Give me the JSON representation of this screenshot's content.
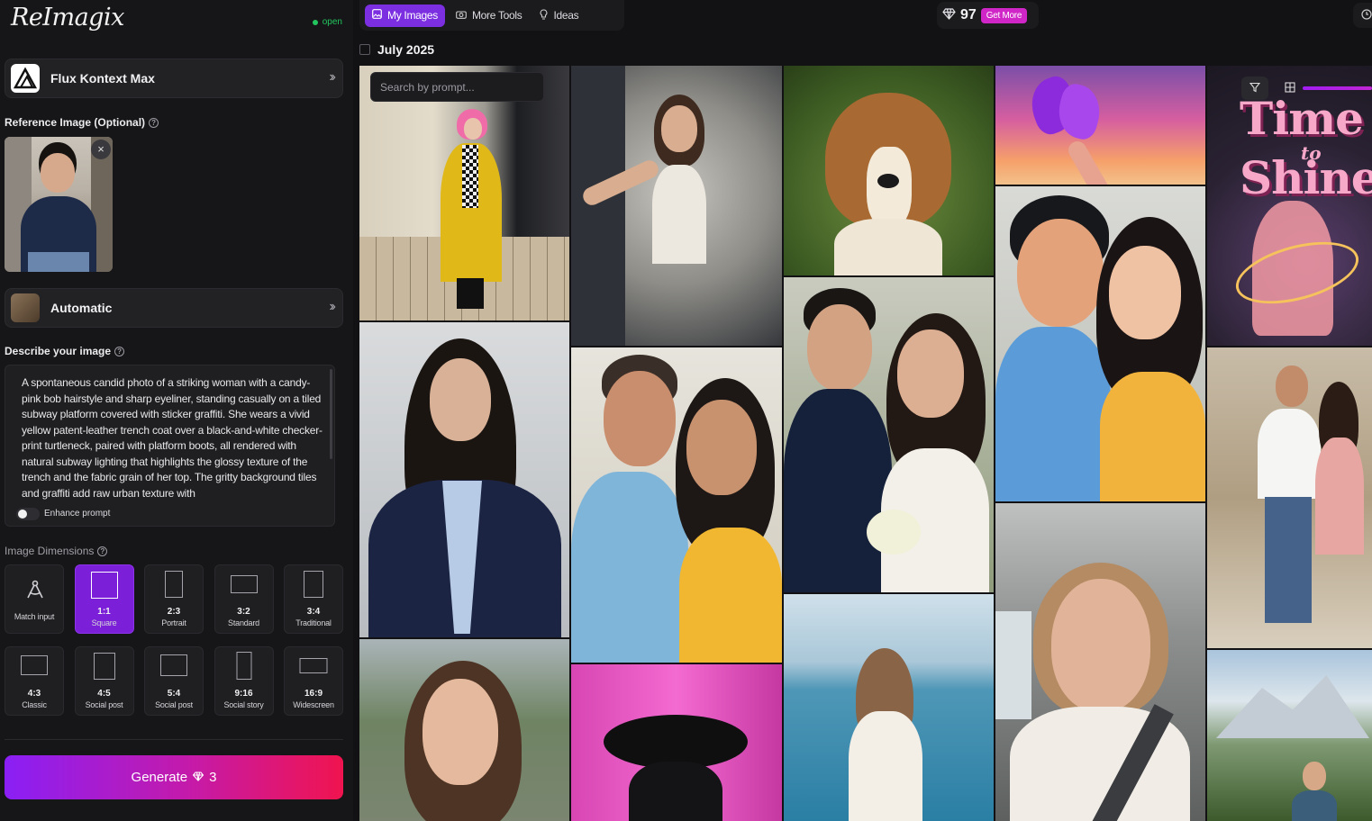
{
  "app": {
    "logo": "ReImagix",
    "status": "open"
  },
  "model": {
    "label": "Flux Kontext Max"
  },
  "reference": {
    "label": "Reference Image (Optional)"
  },
  "style": {
    "label": "Automatic"
  },
  "prompt": {
    "label": "Describe your image",
    "text": "A spontaneous candid photo of a striking woman with a candy-pink bob hairstyle and sharp eyeliner, standing casually on a tiled subway platform covered with sticker graffiti. She wears a vivid yellow patent-leather trench coat over a black-and-white checker-print turtleneck, paired with platform boots, all rendered with natural subway lighting that highlights the glossy texture of the trench and the fabric grain of her top. The gritty background tiles and graffiti add raw urban texture with",
    "enhance_label": "Enhance prompt",
    "enhance_on": false
  },
  "dimensions": {
    "label": "Image Dimensions",
    "selected": "1:1",
    "options": [
      {
        "ratio": "",
        "name": "Match input"
      },
      {
        "ratio": "1:1",
        "name": "Square"
      },
      {
        "ratio": "2:3",
        "name": "Portrait"
      },
      {
        "ratio": "3:2",
        "name": "Standard"
      },
      {
        "ratio": "3:4",
        "name": "Traditional"
      },
      {
        "ratio": "4:3",
        "name": "Classic"
      },
      {
        "ratio": "4:5",
        "name": "Social post"
      },
      {
        "ratio": "5:4",
        "name": "Social post"
      },
      {
        "ratio": "9:16",
        "name": "Social story"
      },
      {
        "ratio": "16:9",
        "name": "Widescreen"
      }
    ]
  },
  "generate": {
    "label": "Generate",
    "cost": "3"
  },
  "tabs": [
    {
      "label": "My Images",
      "icon": "image-icon",
      "active": true
    },
    {
      "label": "More Tools",
      "icon": "camera-icon",
      "active": false
    },
    {
      "label": "Ideas",
      "icon": "lightbulb-icon",
      "active": false
    }
  ],
  "credits": {
    "count": "97",
    "get_more": "Get More"
  },
  "gallery": {
    "month": "July 2025",
    "search_placeholder": "Search by prompt...",
    "poster_title_1": "Time",
    "poster_to": "to",
    "poster_title_2": "Shine"
  },
  "colors": {
    "accent": "#7b2fe0",
    "gradient_start": "#8a1ff5",
    "gradient_end": "#f0144f",
    "status": "#22c55e",
    "get_more": "#d026c7"
  }
}
